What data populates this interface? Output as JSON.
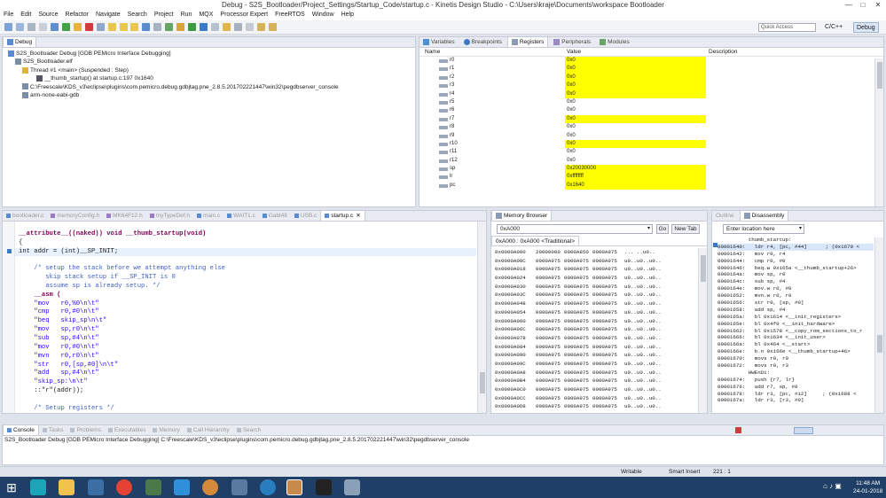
{
  "window": {
    "title": "Debug - S2S_Bootloader/Project_Settings/Startup_Code/startup.c - Kinetis Design Studio - C:\\Users\\kraje\\Documents\\workspace Bootloader",
    "minimize": "—",
    "maximize": "□",
    "close": "✕"
  },
  "menu": [
    "File",
    "Edit",
    "Source",
    "Refactor",
    "Navigate",
    "Search",
    "Project",
    "Run",
    "MQX",
    "Processor Expert",
    "FreeRTOS",
    "Window",
    "Help"
  ],
  "toolbar": {
    "quick_access_placeholder": "Quick Access",
    "perspective_cpp": "C/C++",
    "perspective_debug": "Debug"
  },
  "debug_view": {
    "tab": "Debug",
    "items": [
      "S2S_Bootloader Debug [GDB PEMicro Interface Debugging]",
      "S2S_Bootloader.elf",
      "Thread #1 <main> (Suspended : Step)",
      "__thumb_startup() at startup.c:197 0x1640",
      "C:\\Freescale\\KDS_v3\\eclipse\\plugins\\com.pemicro.debug.gdbjtag.pne_2.8.5.201702221447\\win32\\pegdbserver_console",
      "arm-none-eabi-gdb"
    ]
  },
  "registers_view": {
    "tabs": [
      "Variables",
      "Breakpoints",
      "Registers",
      "Peripherals",
      "Modules"
    ],
    "columns": [
      "Name",
      "Value",
      "Description"
    ],
    "rows": [
      {
        "name": "r0",
        "value": "0x0",
        "changed": true
      },
      {
        "name": "r1",
        "value": "0x0",
        "changed": true
      },
      {
        "name": "r2",
        "value": "0x0",
        "changed": true
      },
      {
        "name": "r3",
        "value": "0x0",
        "changed": true
      },
      {
        "name": "r4",
        "value": "0x0",
        "changed": true
      },
      {
        "name": "r5",
        "value": "0x0",
        "changed": false
      },
      {
        "name": "r6",
        "value": "0x0",
        "changed": false
      },
      {
        "name": "r7",
        "value": "0x0",
        "changed": true
      },
      {
        "name": "r8",
        "value": "0x0",
        "changed": false
      },
      {
        "name": "r9",
        "value": "0x0",
        "changed": false
      },
      {
        "name": "r10",
        "value": "0x0",
        "changed": true
      },
      {
        "name": "r11",
        "value": "0x0",
        "changed": false
      },
      {
        "name": "r12",
        "value": "0x0",
        "changed": false
      },
      {
        "name": "sp",
        "value": "0x20030000",
        "changed": true
      },
      {
        "name": "lr",
        "value": "0xffffffff",
        "changed": true
      },
      {
        "name": "pc",
        "value": "0x1640",
        "changed": true
      }
    ]
  },
  "editor": {
    "tabs": [
      "bootloader.c",
      "memoryConfig.h",
      "MK64F12.h",
      "myTypeDef.h",
      "main.c",
      "WAIT1.c",
      "Gabl48",
      "USB.c",
      "startup.c"
    ],
    "active_tab": "startup.c",
    "lines": [
      "",
      "__attribute__((naked)) void __thumb_startup(void)",
      "{",
      "int addr = (int)__SP_INIT;",
      "",
      "    /* setup the stack before we attempt anything else",
      "       skip stack setup if __SP_INIT is 0",
      "       assume sp is already setup. */",
      "    __asm (",
      "    \"mov   r0,%0\\n\\t\"",
      "    \"cmp   r0,#0\\n\\t\"",
      "    \"beq   skip_sp\\n\\t\"",
      "    \"mov   sp,r0\\n\\t\"",
      "    \"sub   sp,#4\\n\\t\"",
      "    \"mov   r0,#0\\n\\t\"",
      "    \"mvn   r0,r0\\n\\t\"",
      "    \"str   r0,[sp,#0]\\n\\t\"",
      "    \"add   sp,#4\\n\\t\"",
      "    \"skip_sp:\\n\\t\"",
      "    ::\"r\"(addr));",
      "",
      "    /* Setup registers */"
    ]
  },
  "memory_view": {
    "tab": "Memory Browser",
    "address_input": "0xA000",
    "go_button": "Go",
    "new_tab_button": "New Tab",
    "sub_tab": "0xA000 : 0xA000 <Traditional>",
    "rows": [
      {
        "addr": "0x0000A000",
        "w1": "20000000",
        "w2": "0000A850",
        "w3": "0000A975",
        "ascii": "... ..u0.."
      },
      {
        "addr": "0x0000A00C",
        "w1": "0000A975",
        "w2": "0000A975",
        "w3": "0000A975",
        "ascii": "u0..u0..u0.."
      },
      {
        "addr": "0x0000A018",
        "w1": "0000A975",
        "w2": "0000A975",
        "w3": "0000A975",
        "ascii": "u0..u0..u0.."
      },
      {
        "addr": "0x0000A024",
        "w1": "0000A975",
        "w2": "0000A975",
        "w3": "0000A975",
        "ascii": "u0..u0..u0.."
      },
      {
        "addr": "0x0000A030",
        "w1": "0000A975",
        "w2": "0000A975",
        "w3": "0000A975",
        "ascii": "u0..u0..u0.."
      },
      {
        "addr": "0x0000A03C",
        "w1": "0000A975",
        "w2": "0000A975",
        "w3": "0000A975",
        "ascii": "u0..u0..u0.."
      },
      {
        "addr": "0x0000A048",
        "w1": "0000A975",
        "w2": "0000A975",
        "w3": "0000A975",
        "ascii": "u0..u0..u0.."
      },
      {
        "addr": "0x0000A054",
        "w1": "0000A975",
        "w2": "0000A975",
        "w3": "0000A975",
        "ascii": "u0..u0..u0.."
      },
      {
        "addr": "0x0000A060",
        "w1": "0000A975",
        "w2": "0000A975",
        "w3": "0000A975",
        "ascii": "u0..u0..u0.."
      },
      {
        "addr": "0x0000A06C",
        "w1": "0000A975",
        "w2": "0000A975",
        "w3": "0000A975",
        "ascii": "u0..u0..u0.."
      },
      {
        "addr": "0x0000A078",
        "w1": "0000A975",
        "w2": "0000A975",
        "w3": "0000A975",
        "ascii": "u0..u0..u0.."
      },
      {
        "addr": "0x0000A084",
        "w1": "0000A975",
        "w2": "0000A975",
        "w3": "0000A975",
        "ascii": "u0..u0..u0.."
      },
      {
        "addr": "0x0000A090",
        "w1": "0000A975",
        "w2": "0000A975",
        "w3": "0000A975",
        "ascii": "u0..u0..u0.."
      },
      {
        "addr": "0x0000A09C",
        "w1": "0000A975",
        "w2": "0000A975",
        "w3": "0000A975",
        "ascii": "u0..u0..u0.."
      },
      {
        "addr": "0x0000A0A8",
        "w1": "0000A975",
        "w2": "0000A975",
        "w3": "0000A975",
        "ascii": "u0..u0..u0.."
      },
      {
        "addr": "0x0000A0B4",
        "w1": "0000A975",
        "w2": "0000A975",
        "w3": "0000A975",
        "ascii": "u0..u0..u0.."
      },
      {
        "addr": "0x0000A0C0",
        "w1": "0000A975",
        "w2": "0000A975",
        "w3": "0000A975",
        "ascii": "u0..u0..u0.."
      },
      {
        "addr": "0x0000A0CC",
        "w1": "0000A975",
        "w2": "0000A975",
        "w3": "0000A975",
        "ascii": "u0..u0..u0.."
      },
      {
        "addr": "0x0000A0D8",
        "w1": "0000A975",
        "w2": "0000A975",
        "w3": "0000A975",
        "ascii": "u0..u0..u0.."
      }
    ]
  },
  "disassembly_view": {
    "tabs": [
      "Outline",
      "Disassembly"
    ],
    "location_placeholder": "Enter location here",
    "lines": [
      "          thumb_startup:",
      "00001640:   ldr r4, [pc, #44]      ; (0x1670 <",
      "00001642:   mov r0, r4",
      "00001644:   cmp r0, #0",
      "00001646:   beq.w 0x165a <__thumb_startup+26>",
      "0000164a:   mov sp, r0",
      "0000164c:   sub sp, #4",
      "0000164e:   mov.w r0, #0",
      "00001652:   mvn.w r0, r0",
      "00001656:   str r0, [sp, #0]",
      "00001658:   add sp, #4",
      "0000165a:   bl 0x1614 <__init_registers>",
      "0000165e:   bl 0x4f0 <__init_hardware>",
      "00001662:   bl 0x1578 <__copy_rom_sections_to_r",
      "00001666:   bl 0x1634 <__init_user>",
      "0000166a:   bl 0x464 <__start>",
      "0000166e:   b.n 0x166e <__thumb_startup+46>",
      "00001670:   movs r0, r0",
      "00001672:   movs r0, r3",
      "          HWEnDi:",
      "00001674:   push {r7, lr}",
      "00001676:   add r7, sp, #0",
      "00001678:   ldr r3, [pc, #12]     ; (0x1688 <",
      "0000167a:   ldr r3, [r3, #0]"
    ]
  },
  "console_view": {
    "tabs": [
      "Console",
      "Tasks",
      "Problems",
      "Executables",
      "Memory",
      "Call Hierarchy",
      "Search"
    ],
    "line": "S2S_Bootloader Debug [GDB PEMicro Interface Debugging] C:\\Freescale\\KDS_v3\\eclipse\\plugins\\com.pemicro.debug.gdbjtag.pne_2.8.5.201702221447\\win32\\pegdbserver_console"
  },
  "status_bar": {
    "mode": "Writable",
    "insert": "Smart Insert",
    "position": "221 : 1"
  },
  "taskbar": {
    "time": "11:48 AM",
    "date": "24-01-2018"
  },
  "colors": {
    "changed_register": "#ffff00",
    "keyword": "#7f0055",
    "comment": "#3f5fbf",
    "string": "#2a00ff",
    "taskbar": "#1f3f66"
  }
}
